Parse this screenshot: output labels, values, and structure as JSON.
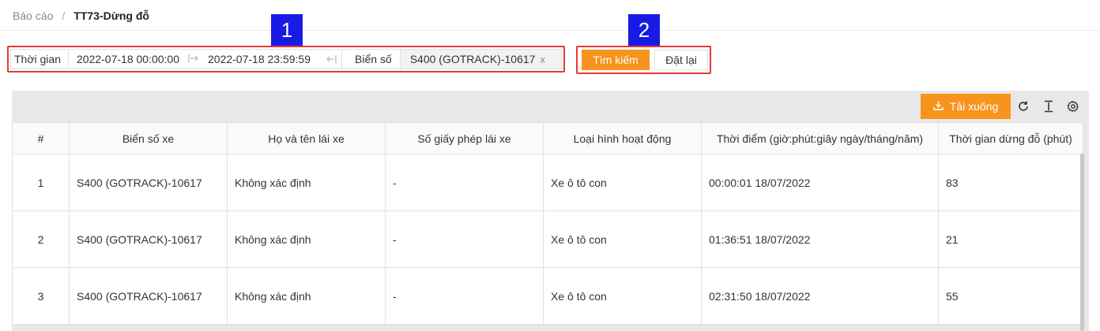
{
  "breadcrumb": {
    "parent": "Báo cáo",
    "separator": "/",
    "current": "TT73-Dừng đỗ"
  },
  "annotations": {
    "badge1": "1",
    "badge2": "2"
  },
  "filter": {
    "time_label": "Thời gian",
    "start": "2022-07-18 00:00:00",
    "end": "2022-07-18 23:59:59",
    "plate_label": "Biển số",
    "plate_value": "S400 (GOTRACK)-10617",
    "clear_glyph": "x"
  },
  "actions": {
    "search": "Tìm kiếm",
    "reset": "Đặt lại"
  },
  "toolbar": {
    "download": "Tải xuống"
  },
  "table": {
    "headers": [
      "#",
      "Biển số xe",
      "Họ và tên lái xe",
      "Số giấy phép lái xe",
      "Loại hình hoạt động",
      "Thời điểm (giờ:phút:giây ngày/tháng/năm)",
      "Thời gian dừng đỗ (phút)"
    ],
    "rows": [
      [
        "1",
        "S400 (GOTRACK)-10617",
        "Không xác định",
        "-",
        "Xe ô tô con",
        "00:00:01 18/07/2022",
        "83"
      ],
      [
        "2",
        "S400 (GOTRACK)-10617",
        "Không xác định",
        "-",
        "Xe ô tô con",
        "01:36:51 18/07/2022",
        "21"
      ],
      [
        "3",
        "S400 (GOTRACK)-10617",
        "Không xác định",
        "-",
        "Xe ô tô con",
        "02:31:50 18/07/2022",
        "55"
      ]
    ]
  },
  "colors": {
    "accent": "#f7941d",
    "highlight": "#e53935",
    "badge": "#1a1ae6"
  },
  "icons": [
    "download-icon",
    "reload-icon",
    "column-height-icon",
    "settings-icon",
    "arrow-right-icon",
    "arrow-left-icon",
    "close-icon"
  ]
}
